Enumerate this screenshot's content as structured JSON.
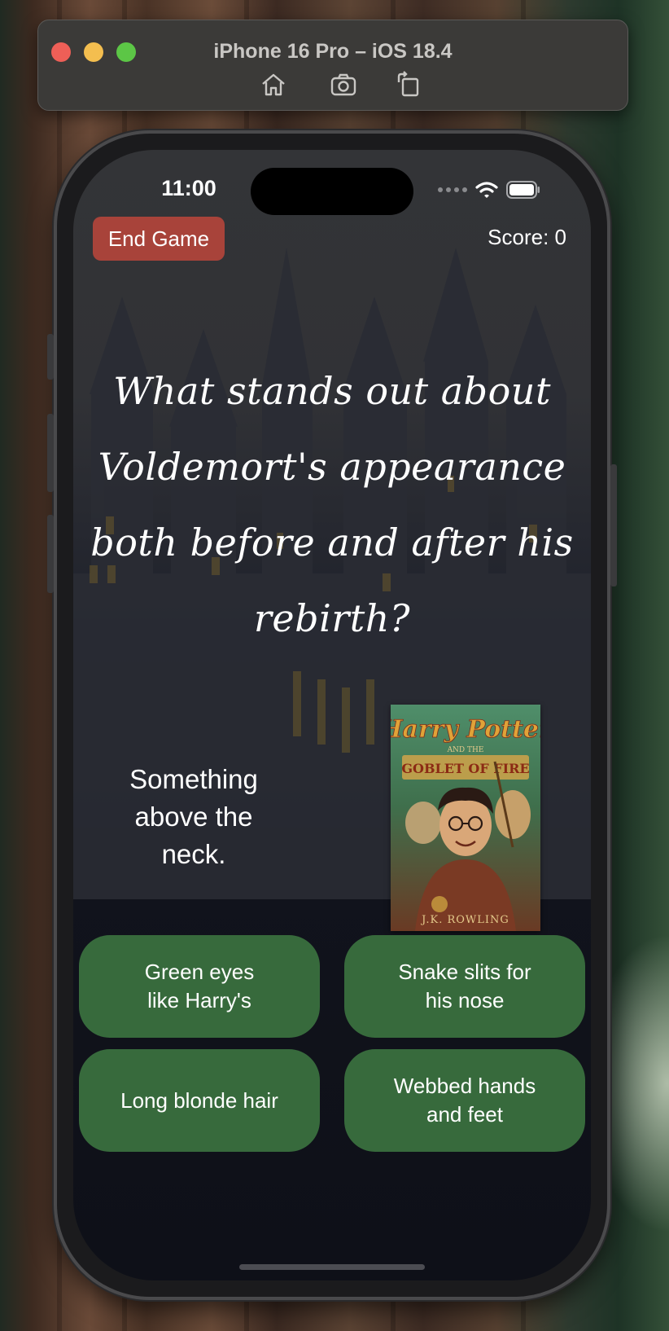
{
  "simulator": {
    "title": "iPhone 16 Pro – iOS 18.4",
    "tools": [
      "home-icon",
      "screenshot-icon",
      "rotate-icon"
    ]
  },
  "status_bar": {
    "time": "11:00"
  },
  "game": {
    "end_button": "End Game",
    "score": "Score: 0",
    "question": "What stands out about Voldemort's appearance both before and after his rebirth?",
    "hint": "Something above the neck.",
    "book_cover": {
      "title_line1": "Harry Potter",
      "title_and_the": "AND THE",
      "title_line2": "GOBLET OF FIRE",
      "author": "J.K. ROWLING"
    },
    "answers": [
      "Green eyes\nlike Harry's",
      "Snake slits for\nhis nose",
      "Long blonde hair",
      "Webbed hands\nand feet"
    ]
  },
  "colors": {
    "end_button": "#a8433a",
    "answer_button": "#376a3c",
    "screen_background": "#11131c"
  }
}
